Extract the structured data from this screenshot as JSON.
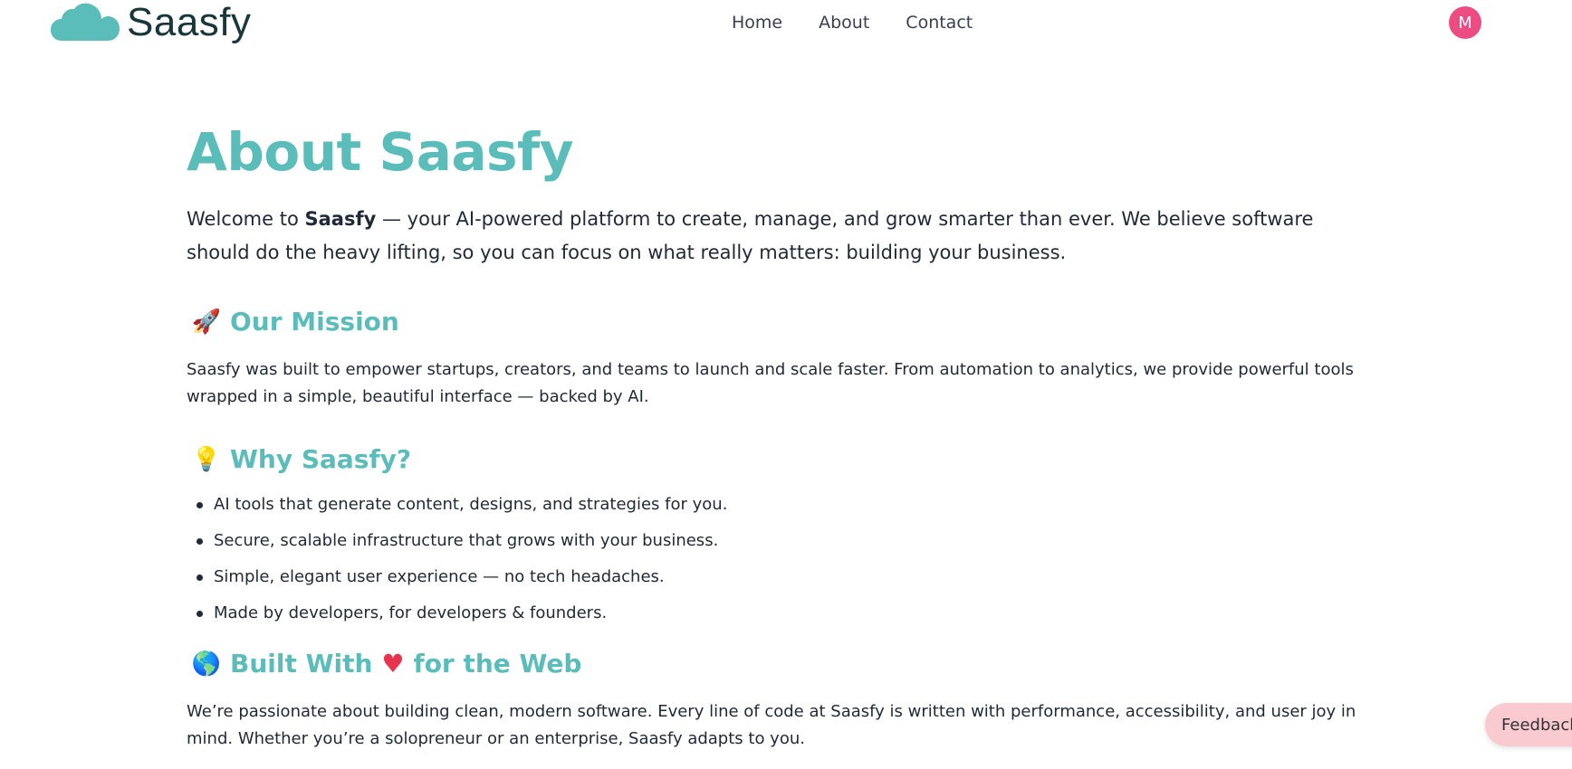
{
  "header": {
    "brand": "Saasfy",
    "nav": [
      {
        "label": "Home"
      },
      {
        "label": "About"
      },
      {
        "label": "Contact"
      }
    ],
    "avatar_initial": "M"
  },
  "main": {
    "title": "About Saasfy",
    "intro": {
      "before": "Welcome to ",
      "brand": "Saasfy",
      "after": " — your AI-powered platform to create, manage, and grow smarter than ever. We believe software should do the heavy lifting, so you can focus on what really matters: building your business."
    },
    "mission": {
      "emoji": "🚀",
      "heading": "Our Mission",
      "text": "Saasfy was built to empower startups, creators, and teams to launch and scale faster. From automation to analytics, we provide powerful tools wrapped in a simple, beautiful interface — backed by AI."
    },
    "why": {
      "emoji": "💡",
      "heading": "Why Saasfy?",
      "items": [
        "AI tools that generate content, designs, and strategies for you.",
        "Secure, scalable infrastructure that grows with your business.",
        "Simple, elegant user experience — no tech headaches.",
        "Made by developers, for developers & founders."
      ]
    },
    "built": {
      "emoji": "🌎",
      "heading_before": "Built With",
      "heart": "♥",
      "heading_after": "for the Web",
      "text": "We’re passionate about building clean, modern software. Every line of code at Saasfy is written with performance, accessibility, and user joy in mind. Whether you’re a solopreneur or an enterprise, Saasfy adapts to you."
    }
  },
  "feedback": {
    "label": "Feedback"
  },
  "colors": {
    "accent": "#5bbdb9",
    "avatar": "#ec4c82",
    "feedback_bg": "#f9cbd0",
    "logo_text": "#17373a"
  }
}
